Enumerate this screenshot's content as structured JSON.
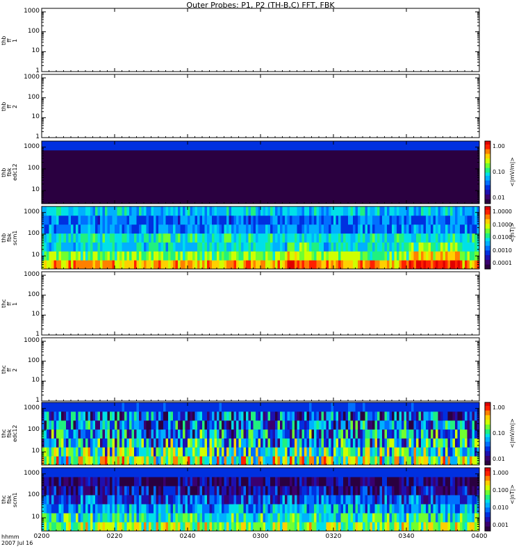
{
  "title": "Outer Probes: P1, P2 (TH-B,C) FFT, FBK",
  "x_axis": {
    "label_line1": "hhmm",
    "label_line2": "2007 Jul 16",
    "ticks": [
      "0200",
      "0220",
      "0240",
      "0300",
      "0320",
      "0340",
      "0400"
    ]
  },
  "chart_data": [
    {
      "type": "heatmap",
      "ylabel": "thb ff 1",
      "yscale": "log",
      "yticks": [
        "1",
        "10",
        "100",
        "1000"
      ],
      "ylim": [
        1,
        1500
      ],
      "content": "empty"
    },
    {
      "type": "heatmap",
      "ylabel": "thb ff 2",
      "yscale": "log",
      "yticks": [
        "1",
        "10",
        "100",
        "1000"
      ],
      "ylim": [
        1,
        1500
      ],
      "content": "empty"
    },
    {
      "type": "heatmap",
      "ylabel": "thb fbk edc12",
      "yscale": "log",
      "yticks": [
        "10",
        "100",
        "1000"
      ],
      "colorbar": {
        "label": "<|mV/m|>",
        "ticks": [
          "1.00",
          "0.10",
          "0.01"
        ]
      },
      "style": "uniform"
    },
    {
      "type": "heatmap",
      "ylabel": "thb fbk scm1",
      "yscale": "log",
      "yticks": [
        "10",
        "100",
        "1000"
      ],
      "colorbar": {
        "label": "<|nT|>",
        "ticks": [
          "1.0000",
          "0.1000",
          "0.0100",
          "0.0010",
          "0.0001"
        ]
      },
      "style": "bands"
    },
    {
      "type": "heatmap",
      "ylabel": "thc ff 1",
      "yscale": "log",
      "yticks": [
        "1",
        "10",
        "100",
        "1000"
      ],
      "ylim": [
        1,
        1500
      ],
      "content": "empty"
    },
    {
      "type": "heatmap",
      "ylabel": "thc ff 2",
      "yscale": "log",
      "yticks": [
        "1",
        "10",
        "100",
        "1000"
      ],
      "ylim": [
        1,
        1500
      ],
      "content": "empty"
    },
    {
      "type": "heatmap",
      "ylabel": "thc fbk edc12",
      "yscale": "log",
      "yticks": [
        "10",
        "100",
        "1000"
      ],
      "colorbar": {
        "label": "<|mV/m|>",
        "ticks": [
          "1.00",
          "0.10",
          "0.01"
        ]
      },
      "style": "noisy"
    },
    {
      "type": "heatmap",
      "ylabel": "thc fbk scm1",
      "yscale": "log",
      "yticks": [
        "10",
        "100",
        "1000"
      ],
      "colorbar": {
        "label": "<|nT|>",
        "ticks": [
          "1.000",
          "0.100",
          "0.010",
          "0.001"
        ]
      },
      "style": "scm"
    }
  ]
}
